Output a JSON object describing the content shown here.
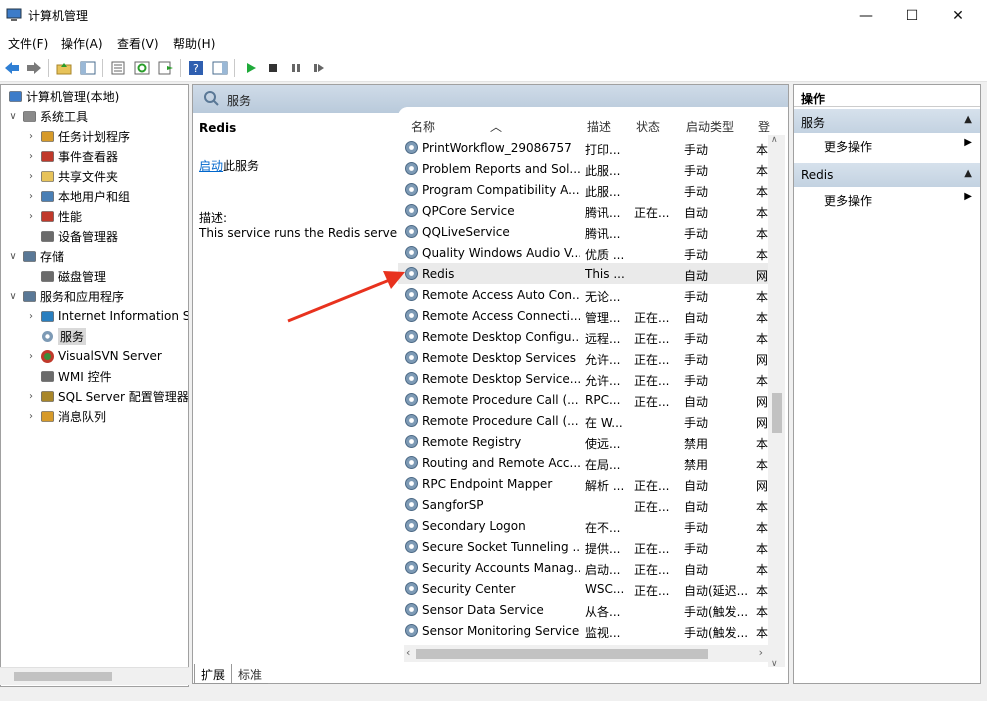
{
  "window": {
    "title": "计算机管理",
    "minimize": "—",
    "maximize": "☐",
    "close": "✕"
  },
  "menu": [
    "文件(F)",
    "操作(A)",
    "查看(V)",
    "帮助(H)"
  ],
  "tree": {
    "items": [
      {
        "label": "计算机管理(本地)",
        "icon": "computer-icon",
        "exp": ""
      },
      {
        "label": "系统工具",
        "icon": "tools-icon",
        "exp": "∨"
      },
      {
        "label": "任务计划程序",
        "icon": "clock-icon",
        "exp": "›"
      },
      {
        "label": "事件查看器",
        "icon": "event-icon",
        "exp": "›"
      },
      {
        "label": "共享文件夹",
        "icon": "folder-icon",
        "exp": "›"
      },
      {
        "label": "本地用户和组",
        "icon": "users-icon",
        "exp": "›"
      },
      {
        "label": "性能",
        "icon": "performance-icon",
        "exp": "›"
      },
      {
        "label": "设备管理器",
        "icon": "device-icon",
        "exp": ""
      },
      {
        "label": "存储",
        "icon": "storage-icon",
        "exp": "∨"
      },
      {
        "label": "磁盘管理",
        "icon": "disk-icon",
        "exp": ""
      },
      {
        "label": "服务和应用程序",
        "icon": "services-apps-icon",
        "exp": "∨"
      },
      {
        "label": "Internet Information Se",
        "icon": "iis-icon",
        "exp": "›"
      },
      {
        "label": "服务",
        "icon": "gear-icon",
        "exp": ""
      },
      {
        "label": "VisualSVN Server",
        "icon": "svn-icon",
        "exp": "›"
      },
      {
        "label": "WMI 控件",
        "icon": "wmi-icon",
        "exp": ""
      },
      {
        "label": "SQL Server 配置管理器",
        "icon": "sql-icon",
        "exp": "›"
      },
      {
        "label": "消息队列",
        "icon": "queue-icon",
        "exp": "›"
      }
    ]
  },
  "middle": {
    "header": "服务",
    "selected_service": "Redis",
    "start_link": "启动",
    "start_suffix": "此服务",
    "desc_label": "描述:",
    "desc_text": "This service runs the Redis server",
    "columns": {
      "name": "名称",
      "desc": "描述",
      "state": "状态",
      "type": "启动类型",
      "logon": "登"
    },
    "rows": [
      {
        "name": "PrintWorkflow_29086757",
        "desc": "打印...",
        "state": "",
        "type": "手动",
        "logon": "本"
      },
      {
        "name": "Problem Reports and Sol...",
        "desc": "此服...",
        "state": "",
        "type": "手动",
        "logon": "本"
      },
      {
        "name": "Program Compatibility A...",
        "desc": "此服...",
        "state": "",
        "type": "手动",
        "logon": "本"
      },
      {
        "name": "QPCore Service",
        "desc": "腾讯...",
        "state": "正在...",
        "type": "自动",
        "logon": "本"
      },
      {
        "name": "QQLiveService",
        "desc": "腾讯...",
        "state": "",
        "type": "手动",
        "logon": "本"
      },
      {
        "name": "Quality Windows Audio V...",
        "desc": "优质 ...",
        "state": "",
        "type": "手动",
        "logon": "本"
      },
      {
        "name": "Redis",
        "desc": "This ...",
        "state": "",
        "type": "自动",
        "logon": "网"
      },
      {
        "name": "Remote Access Auto Con...",
        "desc": "无论...",
        "state": "",
        "type": "手动",
        "logon": "本"
      },
      {
        "name": "Remote Access Connecti...",
        "desc": "管理...",
        "state": "正在...",
        "type": "自动",
        "logon": "本"
      },
      {
        "name": "Remote Desktop Configu...",
        "desc": "远程...",
        "state": "正在...",
        "type": "手动",
        "logon": "本"
      },
      {
        "name": "Remote Desktop Services",
        "desc": "允许...",
        "state": "正在...",
        "type": "手动",
        "logon": "网"
      },
      {
        "name": "Remote Desktop Service...",
        "desc": "允许...",
        "state": "正在...",
        "type": "手动",
        "logon": "本"
      },
      {
        "name": "Remote Procedure Call (...",
        "desc": "RPC...",
        "state": "正在...",
        "type": "自动",
        "logon": "网"
      },
      {
        "name": "Remote Procedure Call (...",
        "desc": "在 W...",
        "state": "",
        "type": "手动",
        "logon": "网"
      },
      {
        "name": "Remote Registry",
        "desc": "使远...",
        "state": "",
        "type": "禁用",
        "logon": "本"
      },
      {
        "name": "Routing and Remote Acc...",
        "desc": "在局...",
        "state": "",
        "type": "禁用",
        "logon": "本"
      },
      {
        "name": "RPC Endpoint Mapper",
        "desc": "解析 ...",
        "state": "正在...",
        "type": "自动",
        "logon": "网"
      },
      {
        "name": "SangforSP",
        "desc": "",
        "state": "正在...",
        "type": "自动",
        "logon": "本"
      },
      {
        "name": "Secondary Logon",
        "desc": "在不...",
        "state": "",
        "type": "手动",
        "logon": "本"
      },
      {
        "name": "Secure Socket Tunneling ...",
        "desc": "提供...",
        "state": "正在...",
        "type": "手动",
        "logon": "本"
      },
      {
        "name": "Security Accounts Manag...",
        "desc": "启动...",
        "state": "正在...",
        "type": "自动",
        "logon": "本"
      },
      {
        "name": "Security Center",
        "desc": "WSC...",
        "state": "正在...",
        "type": "自动(延迟...",
        "logon": "本"
      },
      {
        "name": "Sensor Data Service",
        "desc": "从各...",
        "state": "",
        "type": "手动(触发...",
        "logon": "本"
      },
      {
        "name": "Sensor Monitoring Service",
        "desc": "监视...",
        "state": "",
        "type": "手动(触发...",
        "logon": "本"
      }
    ]
  },
  "tabs": [
    "扩展",
    "标准"
  ],
  "actions": {
    "title": "操作",
    "groups": [
      {
        "label": "服务",
        "item": "更多操作"
      },
      {
        "label": "Redis",
        "item": "更多操作"
      }
    ]
  },
  "colors": {
    "accent": "#0066cc",
    "arrow": "#e8321e"
  }
}
